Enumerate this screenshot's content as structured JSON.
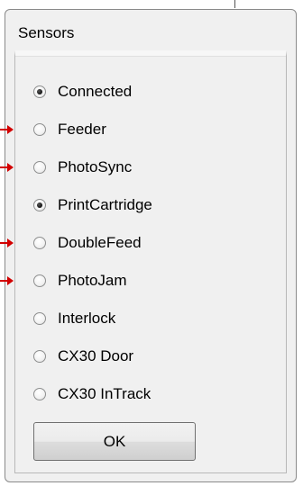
{
  "dialog": {
    "title": "Sensors",
    "ok_label": "OK"
  },
  "sensors": [
    {
      "label": "Connected",
      "checked": true
    },
    {
      "label": "Feeder",
      "checked": false
    },
    {
      "label": "PhotoSync",
      "checked": false
    },
    {
      "label": "PrintCartridge",
      "checked": true
    },
    {
      "label": "DoubleFeed",
      "checked": false
    },
    {
      "label": "PhotoJam",
      "checked": false
    },
    {
      "label": "Interlock",
      "checked": false
    },
    {
      "label": "CX30 Door",
      "checked": false
    },
    {
      "label": "CX30 InTrack",
      "checked": false
    }
  ],
  "annotation_color": "#d20000"
}
